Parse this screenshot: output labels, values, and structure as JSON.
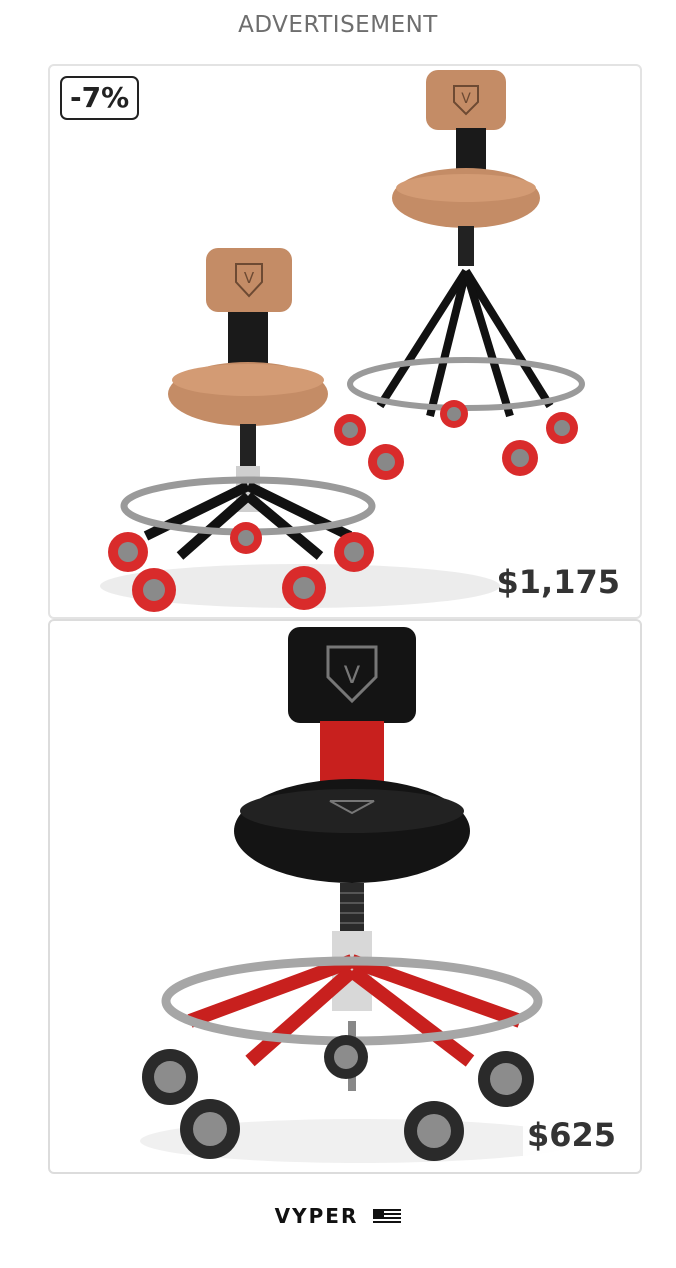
{
  "ad": {
    "label": "ADVERTISEMENT",
    "accent_color": "#1aa6c8"
  },
  "products": [
    {
      "discount_badge": "-7%",
      "price": "$1,175",
      "seat_color": "#c48c66",
      "frame_color": "#111111"
    },
    {
      "price": "$625",
      "seat_color": "#111111",
      "frame_color": "#c8201e"
    }
  ],
  "footer": {
    "brand": "VYPER"
  },
  "icons": {
    "adchoices": "adchoices-icon",
    "close": "close-icon",
    "flag": "us-flag-icon"
  }
}
